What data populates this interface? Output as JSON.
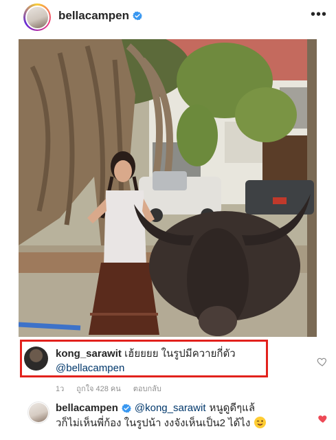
{
  "post": {
    "username": "bellacampen",
    "more_label": "•••"
  },
  "comments": [
    {
      "username": "kong_sarawit",
      "text": "เฮ้ยยยย ในรูปมีควายกี่ตัว",
      "mention": "@bellacampen",
      "time": "1ว",
      "likes": "ถูกใจ 428 คน",
      "reply": "ตอบกลับ",
      "liked": false,
      "highlight_color": "#e2211c"
    },
    {
      "username": "bellacampen",
      "mention": "@kong_sarawit",
      "text_line1": "หนูดูดีๆแล้",
      "text_line2": "วก็ไม่เห็นพี่ก้อง ในรูปน้า งงจังเห็นเป็น2 ได้ไง",
      "liked": true,
      "heart_color": "#ed4956"
    }
  ],
  "icons": {
    "verified_color": "#3897f0"
  }
}
